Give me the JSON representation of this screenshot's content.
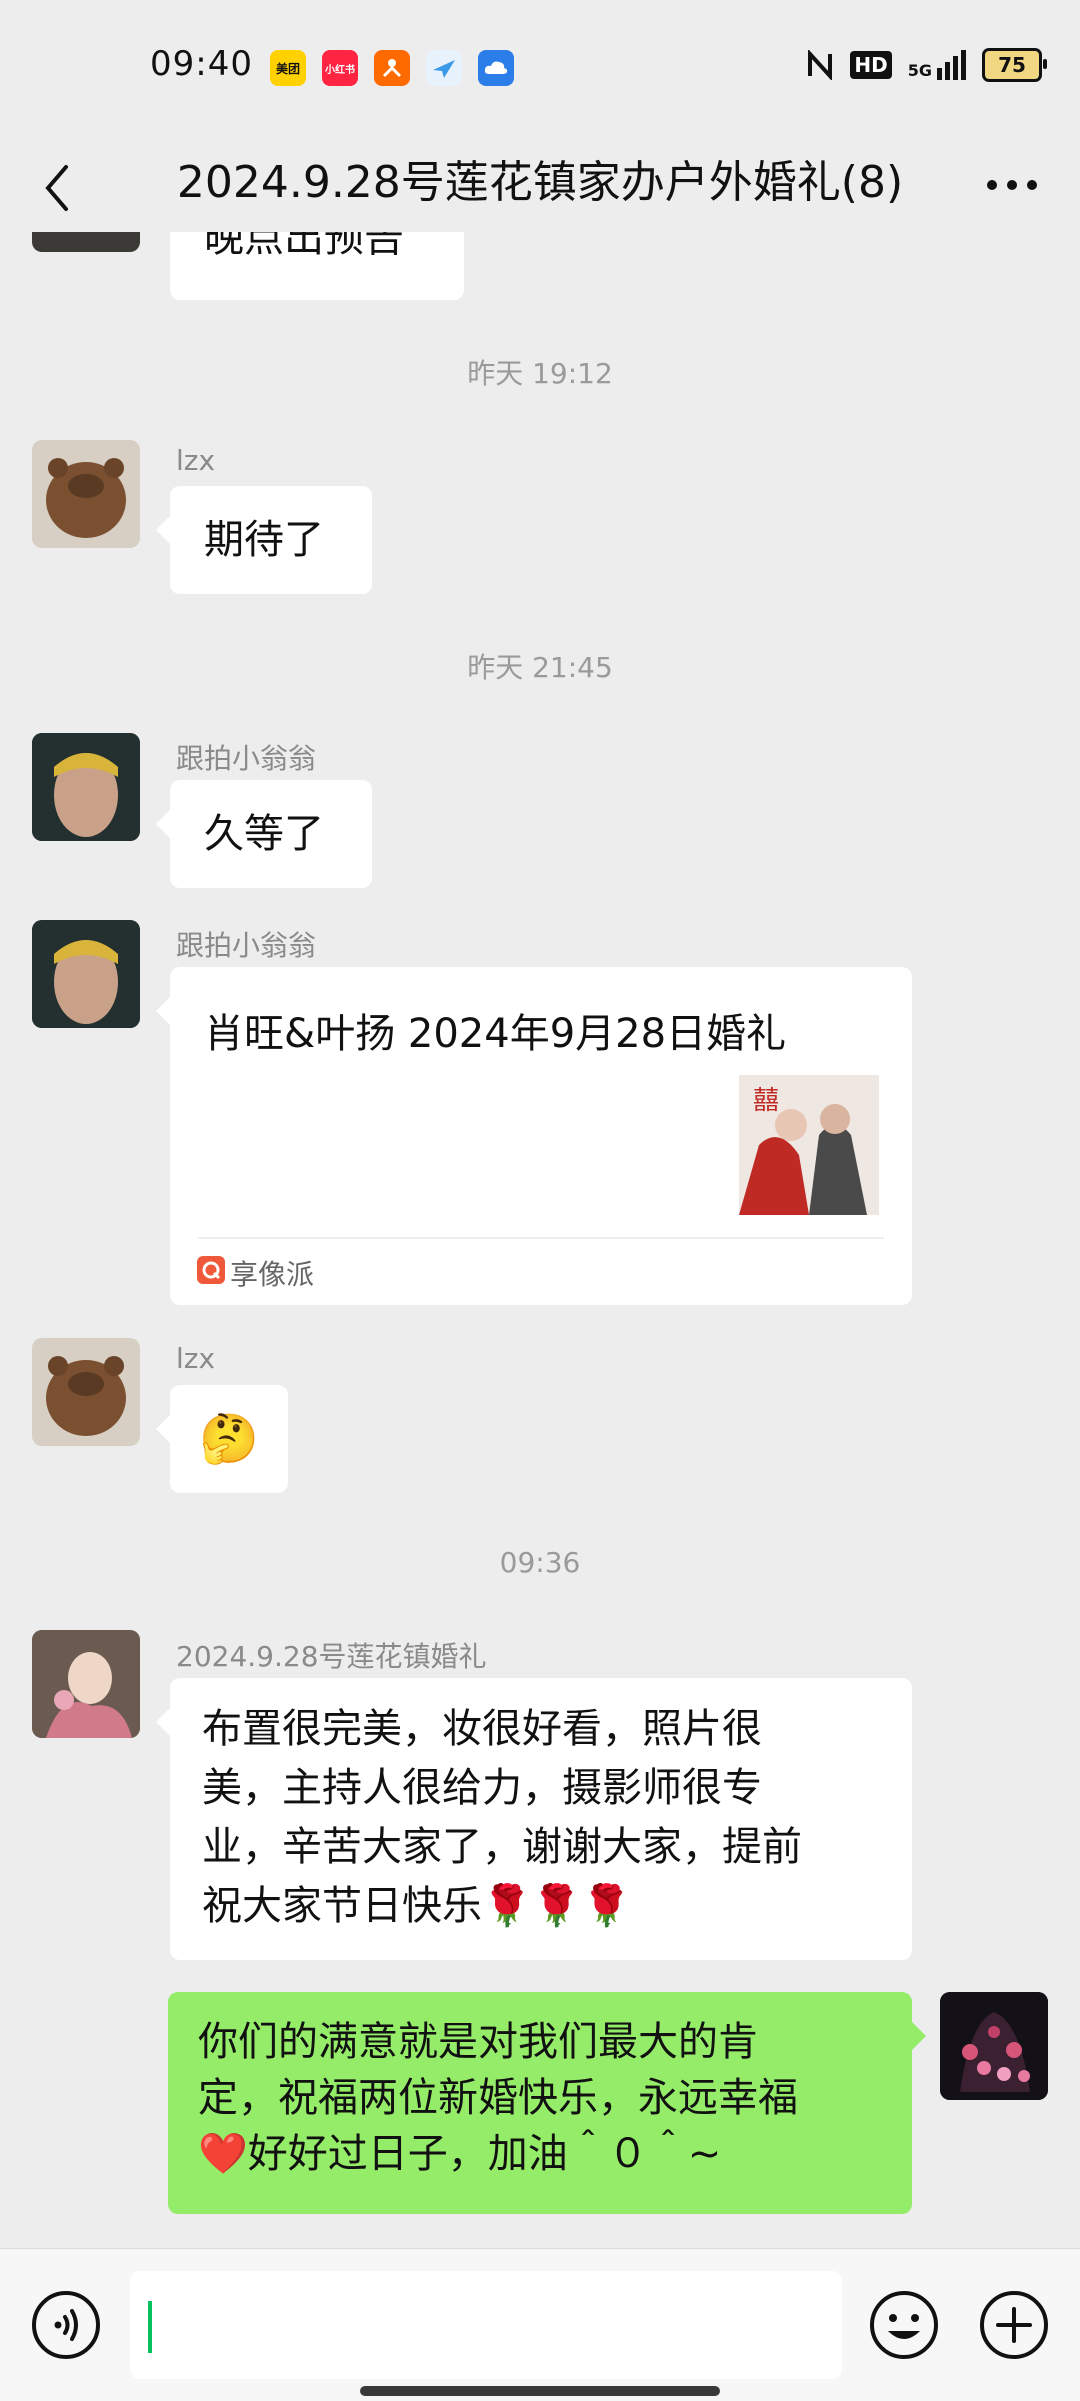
{
  "status": {
    "time": "09:40",
    "battery": "75",
    "network": "5G",
    "hd": "HD",
    "apps": [
      {
        "name": "meituan-icon",
        "label": "美团",
        "color": "#ffd100"
      },
      {
        "name": "xiaohongshu-icon",
        "label": "小红书",
        "color": "#ff2442"
      },
      {
        "name": "taobao-icon",
        "label": "",
        "color": "#ff6a00"
      },
      {
        "name": "flight-icon",
        "label": "",
        "color": "#3a9ae8"
      },
      {
        "name": "cloud-icon",
        "label": "",
        "color": "#2b7de9"
      }
    ]
  },
  "nav": {
    "title": "2024.9.28号莲花镇家办户外婚礼(8)"
  },
  "messages": {
    "partial_text": "晚点出预告",
    "ts1": "昨天 19:12",
    "m1_sender": "lzx",
    "m1_text": "期待了",
    "ts2": "昨天 21:45",
    "m2_sender": "跟拍小翁翁",
    "m2_text": "久等了",
    "m3_sender": "跟拍小翁翁",
    "m3_link_title": "肖旺&叶扬  2024年9月28日婚礼",
    "m3_link_source": "享像派",
    "m4_sender": "lzx",
    "m4_emoji": "🤔",
    "ts3": "09:36",
    "m5_sender": "2024.9.28号莲花镇婚礼",
    "m5_line1": "布置很完美，妆很好看，照片很",
    "m5_line2": "美，主持人很给力，摄影师很专",
    "m5_line3": "业，辛苦大家了，谢谢大家，提前",
    "m5_line4": "祝大家节日快乐🌹🌹🌹",
    "m6_line1": "你们的满意就是对我们最大的肯",
    "m6_line2": "定，祝福两位新婚快乐，永远幸福",
    "m6_line3": "❤️好好过日子，加油＾０＾~"
  },
  "colors": {
    "bubble_self": "#95ec69",
    "bubble_other": "#ffffff",
    "background": "#ededed",
    "caret": "#07c160"
  }
}
